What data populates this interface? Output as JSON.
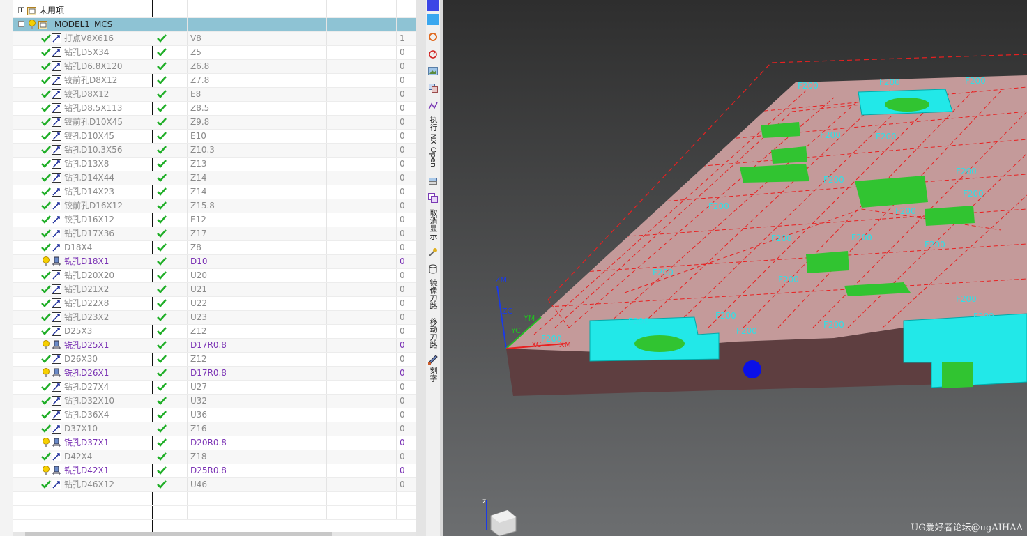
{
  "tree": {
    "unused_label": "未用项",
    "program_group": "_MODEL1_MCS",
    "rows": [
      {
        "name": "打点V8X616",
        "tool": "V8",
        "count": "1",
        "kind": "drill",
        "style": "gray"
      },
      {
        "name": "钻孔D5X34",
        "tool": "Z5",
        "count": "0",
        "kind": "drill",
        "style": "gray"
      },
      {
        "name": "钻孔D6.8X120",
        "tool": "Z6.8",
        "count": "0",
        "kind": "drill",
        "style": "gray"
      },
      {
        "name": "铰前孔D8X12",
        "tool": "Z7.8",
        "count": "0",
        "kind": "drill",
        "style": "gray"
      },
      {
        "name": "铰孔D8X12",
        "tool": "E8",
        "count": "0",
        "kind": "drill",
        "style": "gray"
      },
      {
        "name": "钻孔D8.5X113",
        "tool": "Z8.5",
        "count": "0",
        "kind": "drill",
        "style": "gray"
      },
      {
        "name": "铰前孔D10X45",
        "tool": "Z9.8",
        "count": "0",
        "kind": "drill",
        "style": "gray"
      },
      {
        "name": "铰孔D10X45",
        "tool": "E10",
        "count": "0",
        "kind": "drill",
        "style": "gray"
      },
      {
        "name": "钻孔D10.3X56",
        "tool": "Z10.3",
        "count": "0",
        "kind": "drill",
        "style": "gray"
      },
      {
        "name": "钻孔D13X8",
        "tool": "Z13",
        "count": "0",
        "kind": "drill",
        "style": "gray"
      },
      {
        "name": "钻孔D14X44",
        "tool": "Z14",
        "count": "0",
        "kind": "drill",
        "style": "gray"
      },
      {
        "name": "钻孔D14X23",
        "tool": "Z14",
        "count": "0",
        "kind": "drill",
        "style": "gray"
      },
      {
        "name": "铰前孔D16X12",
        "tool": "Z15.8",
        "count": "0",
        "kind": "drill",
        "style": "gray"
      },
      {
        "name": "铰孔D16X12",
        "tool": "E12",
        "count": "0",
        "kind": "drill",
        "style": "gray"
      },
      {
        "name": "钻孔D17X36",
        "tool": "Z17",
        "count": "0",
        "kind": "drill",
        "style": "gray"
      },
      {
        "name": "D18X4",
        "tool": "Z8",
        "count": "0",
        "kind": "drill",
        "style": "gray"
      },
      {
        "name": "铣孔D18X1",
        "tool": "D10",
        "count": "0",
        "kind": "mill",
        "style": "purple"
      },
      {
        "name": "钻孔D20X20",
        "tool": "U20",
        "count": "0",
        "kind": "drill",
        "style": "gray"
      },
      {
        "name": "钻孔D21X2",
        "tool": "U21",
        "count": "0",
        "kind": "drill",
        "style": "gray"
      },
      {
        "name": "钻孔D22X8",
        "tool": "U22",
        "count": "0",
        "kind": "drill",
        "style": "gray"
      },
      {
        "name": "钻孔D23X2",
        "tool": "U23",
        "count": "0",
        "kind": "drill",
        "style": "gray"
      },
      {
        "name": "D25X3",
        "tool": "Z12",
        "count": "0",
        "kind": "drill",
        "style": "gray"
      },
      {
        "name": "铣孔D25X1",
        "tool": "D17R0.8",
        "count": "0",
        "kind": "mill",
        "style": "purple"
      },
      {
        "name": "D26X30",
        "tool": "Z12",
        "count": "0",
        "kind": "drill",
        "style": "gray"
      },
      {
        "name": "铣孔D26X1",
        "tool": "D17R0.8",
        "count": "0",
        "kind": "mill",
        "style": "purple"
      },
      {
        "name": "钻孔D27X4",
        "tool": "U27",
        "count": "0",
        "kind": "drill",
        "style": "gray"
      },
      {
        "name": "钻孔D32X10",
        "tool": "U32",
        "count": "0",
        "kind": "drill",
        "style": "gray"
      },
      {
        "name": "钻孔D36X4",
        "tool": "U36",
        "count": "0",
        "kind": "drill",
        "style": "gray"
      },
      {
        "name": "D37X10",
        "tool": "Z16",
        "count": "0",
        "kind": "drill",
        "style": "gray"
      },
      {
        "name": "铣孔D37X1",
        "tool": "D20R0.8",
        "count": "0",
        "kind": "mill",
        "style": "purple"
      },
      {
        "name": "D42X4",
        "tool": "Z18",
        "count": "0",
        "kind": "drill",
        "style": "gray"
      },
      {
        "name": "铣孔D42X1",
        "tool": "D25R0.8",
        "count": "0",
        "kind": "mill",
        "style": "purple"
      },
      {
        "name": "钻孔D46X12",
        "tool": "U46",
        "count": "0",
        "kind": "drill",
        "style": "gray"
      }
    ]
  },
  "toolbar": {
    "run_nx_open": "执行 NX Open",
    "cancel_display": "取消显示",
    "mirror_toolpath": "镜像刀路",
    "move_toolpath": "移动刀路",
    "engrave": "刻字"
  },
  "viewport": {
    "axis_labels": {
      "zm": "ZM",
      "zc": "ZC",
      "ym": "YM",
      "yc": "YC",
      "xc": "XC",
      "xm": "XM"
    },
    "feed_label": "F200",
    "watermark": "UG爱好者论坛@ugAIHAA"
  },
  "colors": {
    "selected_row": "#8ec3d4",
    "gray_text": "#8a8a8a",
    "purple_text": "#7a32b4",
    "check_green": "#1fae27",
    "part_top": "#c49a9a",
    "pocket_cyan": "#22e8e8",
    "feature_green": "#31c431"
  }
}
